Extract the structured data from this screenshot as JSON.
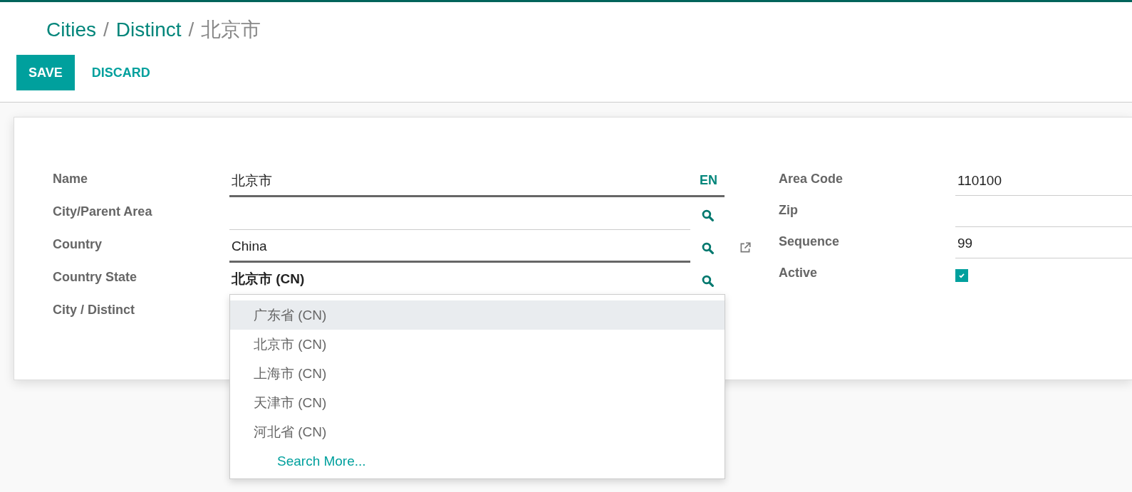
{
  "breadcrumb": {
    "links": [
      "Cities",
      "Distinct"
    ],
    "separator": "/",
    "current": "北京市"
  },
  "buttons": [
    {
      "label": "SAVE",
      "kind": "primary"
    },
    {
      "label": "DISCARD",
      "kind": "link"
    }
  ],
  "left_fields": [
    {
      "label": "Name",
      "kind": "translatable",
      "value": "北京市",
      "lang": "EN",
      "required": true,
      "focused": false
    },
    {
      "label": "City/Parent Area",
      "kind": "many2one",
      "required": false,
      "focused": false
    },
    {
      "label": "Country",
      "kind": "many2one",
      "value": "China",
      "required": true,
      "focused": false,
      "external_link": true
    },
    {
      "label": "Country State",
      "kind": "many2one",
      "value": "北京市 (CN)",
      "required": false,
      "focused": true
    },
    {
      "label": "City / Distinct",
      "kind": "empty"
    }
  ],
  "right_fields": [
    {
      "label": "Area Code",
      "kind": "text",
      "value": "110100"
    },
    {
      "label": "Zip",
      "kind": "text"
    },
    {
      "label": "Sequence",
      "kind": "text",
      "value": "99"
    },
    {
      "label": "Active",
      "kind": "checkbox",
      "checked": true
    }
  ],
  "dropdown": {
    "items": [
      {
        "label": "广东省 (CN)",
        "selected": true
      },
      {
        "label": "北京市 (CN)",
        "selected": false
      },
      {
        "label": "上海市 (CN)",
        "selected": false
      },
      {
        "label": "天津市 (CN)",
        "selected": false
      },
      {
        "label": "河北省 (CN)",
        "selected": false
      }
    ],
    "search_more": "Search More..."
  }
}
